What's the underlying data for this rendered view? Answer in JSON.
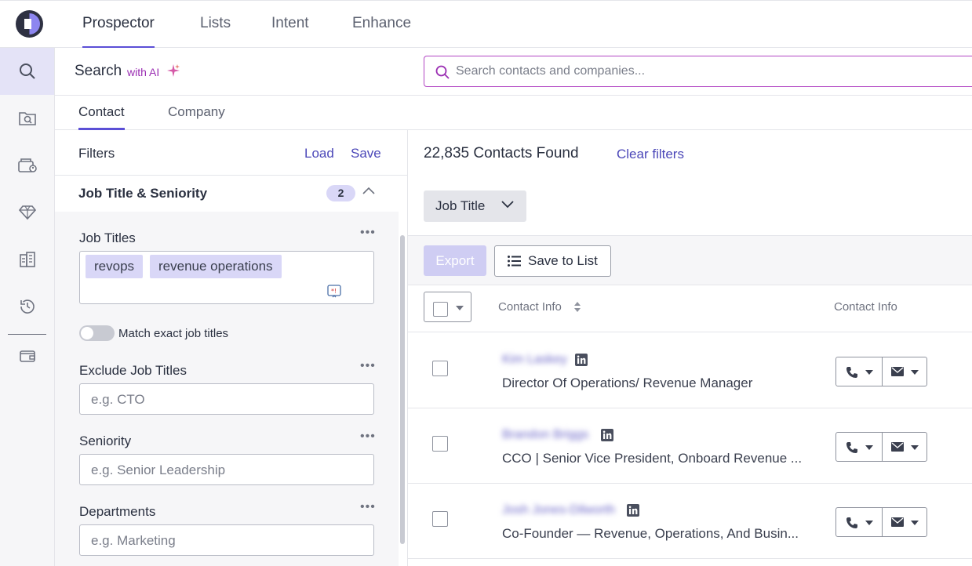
{
  "nav": {
    "tabs": [
      "Prospector",
      "Lists",
      "Intent",
      "Enhance"
    ],
    "active_tab": "Prospector"
  },
  "rail": {
    "items": [
      "search-icon",
      "folder-search-icon",
      "contact-card-icon",
      "gem-icon",
      "buildings-icon",
      "history-icon",
      "wallet-icon"
    ]
  },
  "search": {
    "title": "Search",
    "with_ai": "with AI",
    "placeholder": "Search contacts and companies..."
  },
  "subtabs": [
    "Contact",
    "Company"
  ],
  "filters": {
    "label": "Filters",
    "load": "Load",
    "save": "Save",
    "section_title": "Job Title & Seniority",
    "section_count": "2",
    "job_titles_label": "Job Titles",
    "job_title_tags": [
      "revops",
      "revenue operations"
    ],
    "match_exact_label": "Match exact job titles",
    "exclude_label": "Exclude Job Titles",
    "exclude_placeholder": "e.g. CTO",
    "seniority_label": "Seniority",
    "seniority_placeholder": "e.g. Senior Leadership",
    "departments_label": "Departments",
    "departments_placeholder": "e.g. Marketing",
    "more": "•••"
  },
  "results": {
    "found": "22,835 Contacts Found",
    "clear_filters": "Clear filters",
    "column_dropdown": "Job Title",
    "export": "Export",
    "save_to_list": "Save to List",
    "col_contact_info": "Contact Info",
    "col_contact_info_2": "Contact Info",
    "rows": [
      {
        "name": "Kim Laskey",
        "title": "Director Of Operations/ Revenue Manager"
      },
      {
        "name": "Brandon Briggs",
        "title": "CCO | Senior Vice President, Onboard Revenue ..."
      },
      {
        "name": "Josh Jones-Dilworth",
        "title": "Co-Founder — Revenue, Operations, And Busin..."
      }
    ]
  },
  "colors": {
    "accent": "#5b4fd6",
    "ai": "#9b2fb3",
    "tag_bg": "#d9d7f7"
  }
}
